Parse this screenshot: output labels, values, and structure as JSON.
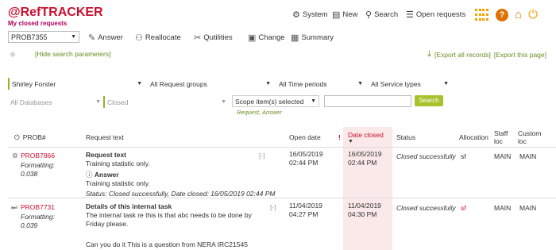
{
  "header": {
    "logo_ref": "@RefTRACKER",
    "subtitle": "My closed requests",
    "nav": [
      {
        "icon": "gear-icon",
        "label": "System"
      },
      {
        "icon": "document-icon",
        "label": "New"
      },
      {
        "icon": "search-icon",
        "label": "Search"
      },
      {
        "icon": "list-icon",
        "label": "Open requests"
      }
    ]
  },
  "toolbar": {
    "prob_value": "PROB7355",
    "buttons": [
      {
        "icon": "answer-icon",
        "label": "Answer"
      },
      {
        "icon": "reallocate-icon",
        "label": "Reallocate"
      },
      {
        "icon": "utilities-icon",
        "label": "Qutilities"
      },
      {
        "icon": "change-icon",
        "label": "Change"
      },
      {
        "icon": "summary-icon",
        "label": "Summary"
      }
    ],
    "hide_params": "[Hide search parameters]",
    "export_all": "[Export all records]",
    "export_page": "[Export this page]"
  },
  "filters": {
    "user": "Shirley Forster",
    "groups": "All Request groups",
    "time": "All Time periods",
    "service": "All Service types",
    "databases": "All Databases",
    "status": "Closed",
    "scope": "Scope item(s) selected",
    "scope_sub": "Request, Answer",
    "search_input": "",
    "search_label": "Search"
  },
  "table": {
    "headers": {
      "prob": "PROB#",
      "request": "Request text",
      "open": "Open date",
      "closed": "Date closed",
      "status": "Status",
      "allocation": "Allocation",
      "staff": "Staff loc",
      "customer": "Custom loc"
    },
    "rows": [
      {
        "prob": "PROB7866",
        "formatting": "Formatting: 0.038",
        "req_title": "Request text",
        "req_body": "Training statistic only.",
        "answer_title": "Answer",
        "answer_body": "Training statistic only.",
        "status_line": "Status: Closed successfully, Date closed: 16/05/2019 02:44 PM",
        "open": "16/05/2019 02:44 PM",
        "closed": "16/05/2019 02:44 PM",
        "status": "Closed successfully",
        "allocation": "sf",
        "staff": "MAIN",
        "customer": "MAIN",
        "expand": "[-]"
      },
      {
        "prob": "PROB7731",
        "formatting": "Formatting: 0.039",
        "req_title": "Details of this internal task",
        "req_body": "The internal task re this is that abc needs to be done by Friday please.",
        "req_extra": "Can you do it This is a question from NERA IRC21545",
        "open": "11/04/2019 04:27 PM",
        "closed": "11/04/2019 04:30 PM",
        "status": "Closed successfully",
        "allocation": "sf",
        "staff": "MAIN",
        "customer": "MAIN",
        "expand": "[-]"
      }
    ]
  }
}
